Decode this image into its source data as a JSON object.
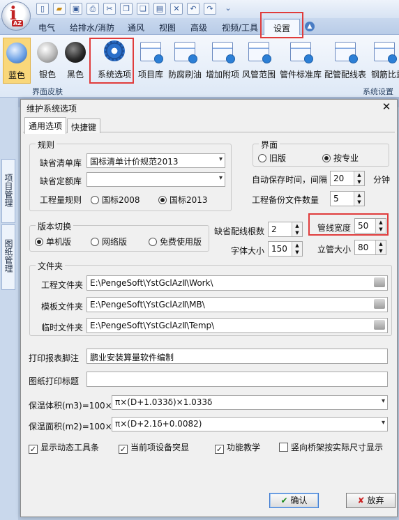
{
  "menu": {
    "tabs": [
      "电气",
      "给排水/消防",
      "通风",
      "视图",
      "高级",
      "视频/工具",
      "设置"
    ]
  },
  "ribbon": {
    "skins": [
      "蓝色",
      "银色",
      "黑色"
    ],
    "buttons": [
      "系统选项",
      "项目库",
      "防腐刷油",
      "增加附项",
      "风管范围",
      "管件标准库",
      "配管配线表",
      "钢筋比重"
    ],
    "group_skin": "界面皮肤",
    "group_system": "系统设置"
  },
  "side_tabs": [
    "项目管理",
    "图纸管理"
  ],
  "dialog": {
    "title": "维护系统选项",
    "tabs": [
      "通用选项",
      "快捷键"
    ],
    "rules": {
      "legend": "规则",
      "bill_label": "缺省清单库",
      "bill_value": "国标清单计价规范2013",
      "quota_label": "缺省定额库",
      "quota_value": "",
      "qty_rule_label": "工程量规则",
      "qty_options": [
        "国标2008",
        "国标2013"
      ]
    },
    "interface": {
      "legend": "界面",
      "options": [
        "旧版",
        "按专业"
      ]
    },
    "autosave_label": "自动保存时间，间隔",
    "autosave_value": "20",
    "autosave_unit": "分钟",
    "backup_label": "工程备份文件数量",
    "backup_value": "5",
    "version": {
      "legend": "版本切换",
      "options": [
        "单机版",
        "网络版",
        "免费使用版"
      ]
    },
    "default_wire_label": "缺省配线根数",
    "default_wire_value": "2",
    "font_size_label": "字体大小",
    "font_size_value": "150",
    "pipe_width_label": "管线宽度",
    "pipe_width_value": "50",
    "riser_size_label": "立管大小",
    "riser_size_value": "80",
    "folders": {
      "legend": "文件夹",
      "project_label": "工程文件夹",
      "project_value": "E:\\PengeSoft\\YstGclAzⅡ\\Work\\",
      "template_label": "模板文件夹",
      "template_value": "E:\\PengeSoft\\YstGclAzⅡ\\MB\\",
      "temp_label": "临时文件夹",
      "temp_value": "E:\\PengeSoft\\YstGclAzⅡ\\Temp\\"
    },
    "footer_label": "打印报表脚注",
    "footer_value": "鹏业安装算量软件编制",
    "drawing_title_label": "图纸打印标题",
    "drawing_title_value": "",
    "insul_volume_label": "保温体积(m3)=100×",
    "insul_volume_value": "π×(D+1.033δ)×1.033δ",
    "insul_area_label": "保温面积(m2)=100×",
    "insul_area_value": "π×(D+2.1δ+0.0082)",
    "checkboxes": [
      "显示动态工具条",
      "当前项设备突显",
      "功能教学",
      "竖向桥架按实际尺寸显示"
    ],
    "ok_label": "确认",
    "cancel_label": "放弃"
  }
}
